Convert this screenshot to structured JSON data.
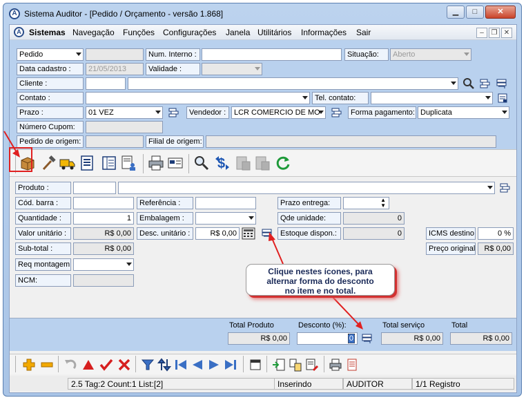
{
  "window": {
    "title": "Sistema Auditor - [Pedido / Orçamento - versão 1.868]"
  },
  "menu": {
    "items": [
      "Sistemas",
      "Navegação",
      "Funções",
      "Configurações",
      "Janela",
      "Utilitários",
      "Informações",
      "Sair"
    ]
  },
  "header": {
    "type_value": "Pedido",
    "num_interno_label": "Num. Interno :",
    "num_interno_value": "",
    "situacao_label": "Situação:",
    "situacao_value": "Aberto",
    "data_cadastro_label": "Data cadastro :",
    "data_cadastro_value": "21/05/2013",
    "validade_label": "Validade :",
    "validade_value": "",
    "cliente_label": "Cliente :",
    "cliente_code": "",
    "cliente_name": "",
    "contato_label": "Contato :",
    "contato_value": "",
    "tel_contato_label": "Tel. contato:",
    "tel_contato_value": "",
    "prazo_label": "Prazo :",
    "prazo_value": "01 VEZ",
    "vendedor_label": "Vendedor :",
    "vendedor_value": "LCR COMERCIO DE MO",
    "forma_pagamento_label": "Forma pagamento:",
    "forma_pagamento_value": "Duplicata",
    "numero_cupom_label": "Número Cupom:",
    "numero_cupom_value": "",
    "pedido_origem_label": "Pedido de origem:",
    "pedido_origem_value": "",
    "filial_origem_label": "Filial de origem:",
    "filial_origem_value": ""
  },
  "item": {
    "produto_label": "Produto :",
    "produto_code": "",
    "produto_desc": "",
    "cod_barra_label": "Cód. barra :",
    "cod_barra_value": "",
    "referencia_label": "Referência :",
    "referencia_value": "",
    "prazo_entrega_label": "Prazo entrega:",
    "prazo_entrega_value": "",
    "quantidade_label": "Quantidade :",
    "quantidade_value": "1",
    "embalagem_label": "Embalagem :",
    "embalagem_value": "",
    "qde_unidade_label": "Qde unidade:",
    "qde_unidade_value": "0",
    "valor_unitario_label": "Valor unitário :",
    "valor_unitario_value": "R$ 0,00",
    "desc_unitario_label": "Desc. unitário :",
    "desc_unitario_value": "R$ 0,00",
    "estoque_label": "Estoque dispon.:",
    "estoque_value": "0",
    "icms_label": "ICMS destino",
    "icms_value": "0 %",
    "subtotal_label": "Sub-total :",
    "subtotal_value": "R$ 0,00",
    "preco_original_label": "Preço original",
    "preco_original_value": "R$ 0,00",
    "req_montagem_label": "Req montagem.:",
    "req_montagem_value": "",
    "ncm_label": "NCM:",
    "ncm_value": ""
  },
  "totals": {
    "total_produto_label": "Total Produto",
    "total_produto_value": "R$ 0,00",
    "desconto_label": "Desconto (%):",
    "desconto_value": "0",
    "total_servico_label": "Total serviço",
    "total_servico_value": "R$ 0,00",
    "total_label": "Total",
    "total_value": "R$ 0,00"
  },
  "tooltip": {
    "line1": "Clique nestes ícones, para",
    "line2": "alternar forma do desconto",
    "line3": "no item e no total."
  },
  "statusbar": {
    "info": "2.5 Tag:2 Count:1 List:[2]",
    "mode": "Inserindo",
    "user": "AUDITOR",
    "record": "1/1 Registro"
  },
  "colors": {
    "panel_blue": "#b9d1ee",
    "annotation_red": "#e02020",
    "tooltip_text": "#1a2a58"
  },
  "icons": {
    "toolbar": [
      "box-icon",
      "hammer-icon",
      "truck-icon",
      "list-icon",
      "notebook-icon",
      "document-user-icon",
      "printer-icon",
      "card-icon",
      "search-icon",
      "dollar-icon",
      "document-gray-icon",
      "document-gray-icon",
      "refresh-icon"
    ],
    "nav": [
      "plus-icon",
      "minus-icon",
      "undo-icon",
      "triangle-up-icon",
      "check-icon",
      "x-icon",
      "filter-icon",
      "sort-icon",
      "first-icon",
      "previous-icon",
      "next-icon",
      "last-icon",
      "window-icon",
      "import-icon",
      "transfer-icon",
      "edit-list-icon",
      "printer-icon",
      "report-icon"
    ]
  }
}
